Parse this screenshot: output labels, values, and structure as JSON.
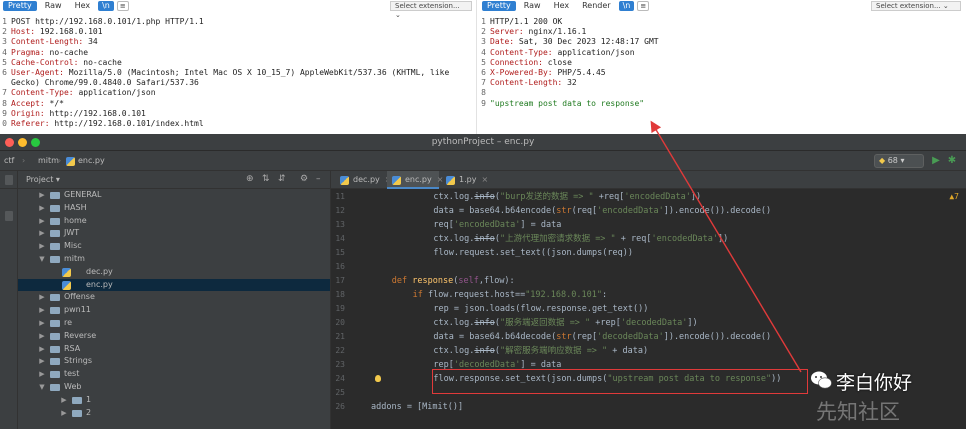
{
  "burp": {
    "request": {
      "tabs": [
        "Pretty",
        "Raw",
        "Hex"
      ],
      "badge": "\\n",
      "selector": "Select extension...",
      "lines": [
        {
          "no": "1",
          "key": "",
          "val": "POST http://192.168.0.101/1.php HTTP/1.1"
        },
        {
          "no": "2",
          "key": "Host:",
          "val": " 192.168.0.101"
        },
        {
          "no": "3",
          "key": "Content-Length:",
          "val": " 34"
        },
        {
          "no": "4",
          "key": "Pragma:",
          "val": " no-cache"
        },
        {
          "no": "5",
          "key": "Cache-Control:",
          "val": " no-cache"
        },
        {
          "no": "6",
          "key": "User-Agent:",
          "val": " Mozilla/5.0 (Macintosh; Intel Mac OS X 10_15_7) AppleWebKit/537.36 (KHTML, like"
        },
        {
          "no": "",
          "key": "",
          "val": "Gecko) Chrome/99.0.4840.0 Safari/537.36"
        },
        {
          "no": "7",
          "key": "Content-Type:",
          "val": " application/json"
        },
        {
          "no": "8",
          "key": "Accept:",
          "val": " */*"
        },
        {
          "no": "9",
          "key": "Origin:",
          "val": " http://192.168.0.101"
        },
        {
          "no": "0",
          "key": "Referer:",
          "val": " http://192.168.0.101/index.html"
        }
      ]
    },
    "response": {
      "tabs": [
        "Pretty",
        "Raw",
        "Hex",
        "Render"
      ],
      "badge": "\\n",
      "selector": "Select extension...",
      "lines": [
        {
          "no": "1",
          "key": "",
          "val": "HTTP/1.1 200 OK"
        },
        {
          "no": "2",
          "key": "Server:",
          "val": " nginx/1.16.1"
        },
        {
          "no": "3",
          "key": "Date:",
          "val": " Sat, 30 Dec 2023 12:48:17 GMT"
        },
        {
          "no": "4",
          "key": "Content-Type:",
          "val": " application/json"
        },
        {
          "no": "5",
          "key": "Connection:",
          "val": " close"
        },
        {
          "no": "6",
          "key": "X-Powered-By:",
          "val": " PHP/5.4.45"
        },
        {
          "no": "7",
          "key": "Content-Length:",
          "val": " 32"
        },
        {
          "no": "8",
          "key": "",
          "val": ""
        },
        {
          "no": "9",
          "key": "",
          "val": "\"upstream post data to response\"",
          "green": true
        }
      ]
    }
  },
  "ide": {
    "window_title": "pythonProject – enc.py",
    "breadcrumb": [
      "ctf",
      "mitm",
      "enc.py"
    ],
    "run_config": "68",
    "project": {
      "title": "Project",
      "tree": [
        {
          "label": "GENERAL",
          "type": "folder",
          "depth": 1,
          "expanded": false
        },
        {
          "label": "HASH",
          "type": "folder",
          "depth": 1,
          "expanded": false
        },
        {
          "label": "home",
          "type": "folder",
          "depth": 1,
          "expanded": false
        },
        {
          "label": "JWT",
          "type": "folder",
          "depth": 1,
          "expanded": false
        },
        {
          "label": "Misc",
          "type": "folder",
          "depth": 1,
          "expanded": false
        },
        {
          "label": "mitm",
          "type": "folder",
          "depth": 1,
          "expanded": true
        },
        {
          "label": "dec.py",
          "type": "file",
          "depth": 2
        },
        {
          "label": "enc.py",
          "type": "file",
          "depth": 2,
          "selected": true
        },
        {
          "label": "Offense",
          "type": "folder",
          "depth": 1,
          "expanded": false
        },
        {
          "label": "pwn11",
          "type": "folder",
          "depth": 1,
          "expanded": false
        },
        {
          "label": "re",
          "type": "folder",
          "depth": 1,
          "expanded": false
        },
        {
          "label": "Reverse",
          "type": "folder",
          "depth": 1,
          "expanded": false
        },
        {
          "label": "RSA",
          "type": "folder",
          "depth": 1,
          "expanded": false
        },
        {
          "label": "Strings",
          "type": "folder",
          "depth": 1,
          "expanded": false
        },
        {
          "label": "test",
          "type": "folder",
          "depth": 1,
          "expanded": false
        },
        {
          "label": "Web",
          "type": "folder",
          "depth": 1,
          "expanded": true
        },
        {
          "label": "1",
          "type": "folder",
          "depth": 2,
          "expanded": false
        },
        {
          "label": "2",
          "type": "folder",
          "depth": 2,
          "expanded": false
        }
      ]
    },
    "tabs": [
      {
        "label": "dec.py",
        "active": false
      },
      {
        "label": "enc.py",
        "active": true
      },
      {
        "label": "1.py",
        "active": false
      }
    ],
    "warning_count": "7",
    "code": [
      {
        "no": "11",
        "indent": 12,
        "tokens": [
          [
            "p",
            "ctx.log."
          ],
          [
            "d",
            "info"
          ],
          [
            "p",
            "("
          ],
          [
            "s",
            "\"burp发送的数据 => \""
          ],
          [
            "p",
            " +req["
          ],
          [
            "s",
            "'encodedData'"
          ],
          [
            "p",
            "])"
          ]
        ]
      },
      {
        "no": "12",
        "indent": 12,
        "tokens": [
          [
            "p",
            "data = base64.b64encode("
          ],
          [
            "k",
            "str"
          ],
          [
            "p",
            "(req["
          ],
          [
            "s",
            "'encodedData'"
          ],
          [
            "p",
            "]).encode()).decode()"
          ]
        ]
      },
      {
        "no": "13",
        "indent": 12,
        "tokens": [
          [
            "p",
            "req["
          ],
          [
            "s",
            "'encodedData'"
          ],
          [
            "p",
            "] = data"
          ]
        ]
      },
      {
        "no": "14",
        "indent": 12,
        "tokens": [
          [
            "p",
            "ctx.log."
          ],
          [
            "d",
            "info"
          ],
          [
            "p",
            "("
          ],
          [
            "s",
            "\"上游代理加密请求数据 => \""
          ],
          [
            "p",
            " + req["
          ],
          [
            "s",
            "'encodedData'"
          ],
          [
            "p",
            "])"
          ]
        ]
      },
      {
        "no": "15",
        "indent": 12,
        "tokens": [
          [
            "p",
            "flow.request.set_text((json.dumps(req))"
          ]
        ]
      },
      {
        "no": "16",
        "indent": 0,
        "tokens": []
      },
      {
        "no": "17",
        "indent": 4,
        "tokens": [
          [
            "k",
            "def "
          ],
          [
            "f",
            "response"
          ],
          [
            "p",
            "("
          ],
          [
            "m",
            "self"
          ],
          [
            "p",
            ",flow):"
          ]
        ]
      },
      {
        "no": "18",
        "indent": 8,
        "tokens": [
          [
            "k",
            "if "
          ],
          [
            "p",
            "flow.request.host=="
          ],
          [
            "s",
            "\"192.168.0.101\""
          ],
          [
            "p",
            ":"
          ]
        ]
      },
      {
        "no": "19",
        "indent": 12,
        "tokens": [
          [
            "p",
            "rep = json.loads(flow.response.get_text())"
          ]
        ]
      },
      {
        "no": "20",
        "indent": 12,
        "tokens": [
          [
            "p",
            "ctx.log."
          ],
          [
            "d",
            "info"
          ],
          [
            "p",
            "("
          ],
          [
            "s",
            "\"服务端返回数据 => \""
          ],
          [
            "p",
            " +rep["
          ],
          [
            "s",
            "'decodedData'"
          ],
          [
            "p",
            "])"
          ]
        ]
      },
      {
        "no": "21",
        "indent": 12,
        "tokens": [
          [
            "p",
            "data = base64.b64decode("
          ],
          [
            "k",
            "str"
          ],
          [
            "p",
            "(rep["
          ],
          [
            "s",
            "'decodedData'"
          ],
          [
            "p",
            "]).encode()).decode()"
          ]
        ]
      },
      {
        "no": "22",
        "indent": 12,
        "tokens": [
          [
            "p",
            "ctx.log."
          ],
          [
            "d",
            "info"
          ],
          [
            "p",
            "("
          ],
          [
            "s",
            "\"解密服务端响应数据 => \""
          ],
          [
            "p",
            " + data)"
          ]
        ]
      },
      {
        "no": "23",
        "indent": 12,
        "tokens": [
          [
            "p",
            "rep["
          ],
          [
            "s",
            "'decodedData'"
          ],
          [
            "p",
            "] = data"
          ]
        ]
      },
      {
        "no": "24",
        "indent": 12,
        "tokens": [
          [
            "p",
            "flow.response.set_text(json.dumps("
          ],
          [
            "s",
            "\"upstream post data to response\""
          ],
          [
            "p",
            "))"
          ]
        ]
      },
      {
        "no": "25",
        "indent": 0,
        "tokens": []
      },
      {
        "no": "26",
        "indent": 0,
        "tokens": [
          [
            "p",
            "addons = [Mimit()]"
          ]
        ]
      }
    ]
  },
  "watermark": {
    "author": "李白你好",
    "site": "先知社区"
  },
  "colors": {
    "annotation": "#e03a3a",
    "burp_accent": "#2f7fd1"
  }
}
